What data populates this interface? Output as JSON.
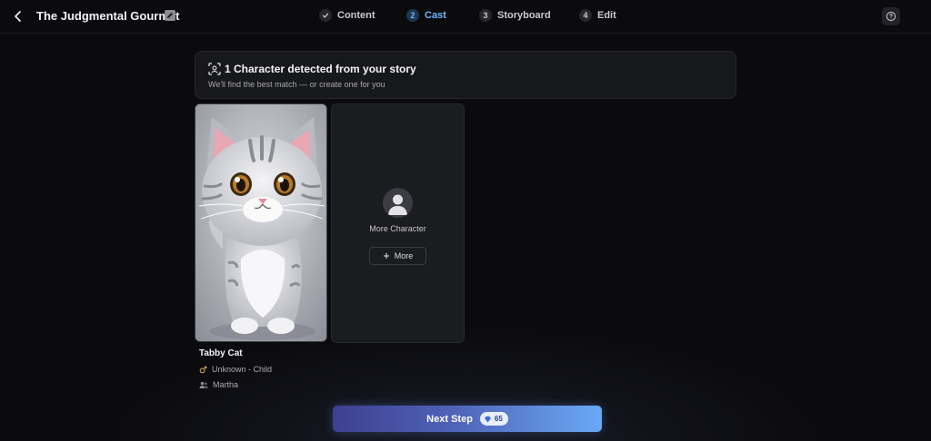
{
  "header": {
    "title": "The Judgmental Gourmet",
    "steps": [
      {
        "num": "",
        "label": "Content",
        "state": "done"
      },
      {
        "num": "2",
        "label": "Cast",
        "state": "active"
      },
      {
        "num": "3",
        "label": "Storyboard",
        "state": "pending"
      },
      {
        "num": "4",
        "label": "Edit",
        "state": "pending"
      }
    ]
  },
  "banner": {
    "title": "1 Character detected from your story",
    "subtitle": "We'll find the best match — or create one for you"
  },
  "character": {
    "name": "Tabby Cat",
    "type": "Unknown - Child",
    "owner": "Martha"
  },
  "more_card": {
    "label": "More Character",
    "button_label": "More"
  },
  "footer": {
    "next_label": "Next Step",
    "credits": "65"
  },
  "colors": {
    "accent": "#6bb6ff",
    "background": "#0b0b0d",
    "card": "#1b1c20"
  }
}
